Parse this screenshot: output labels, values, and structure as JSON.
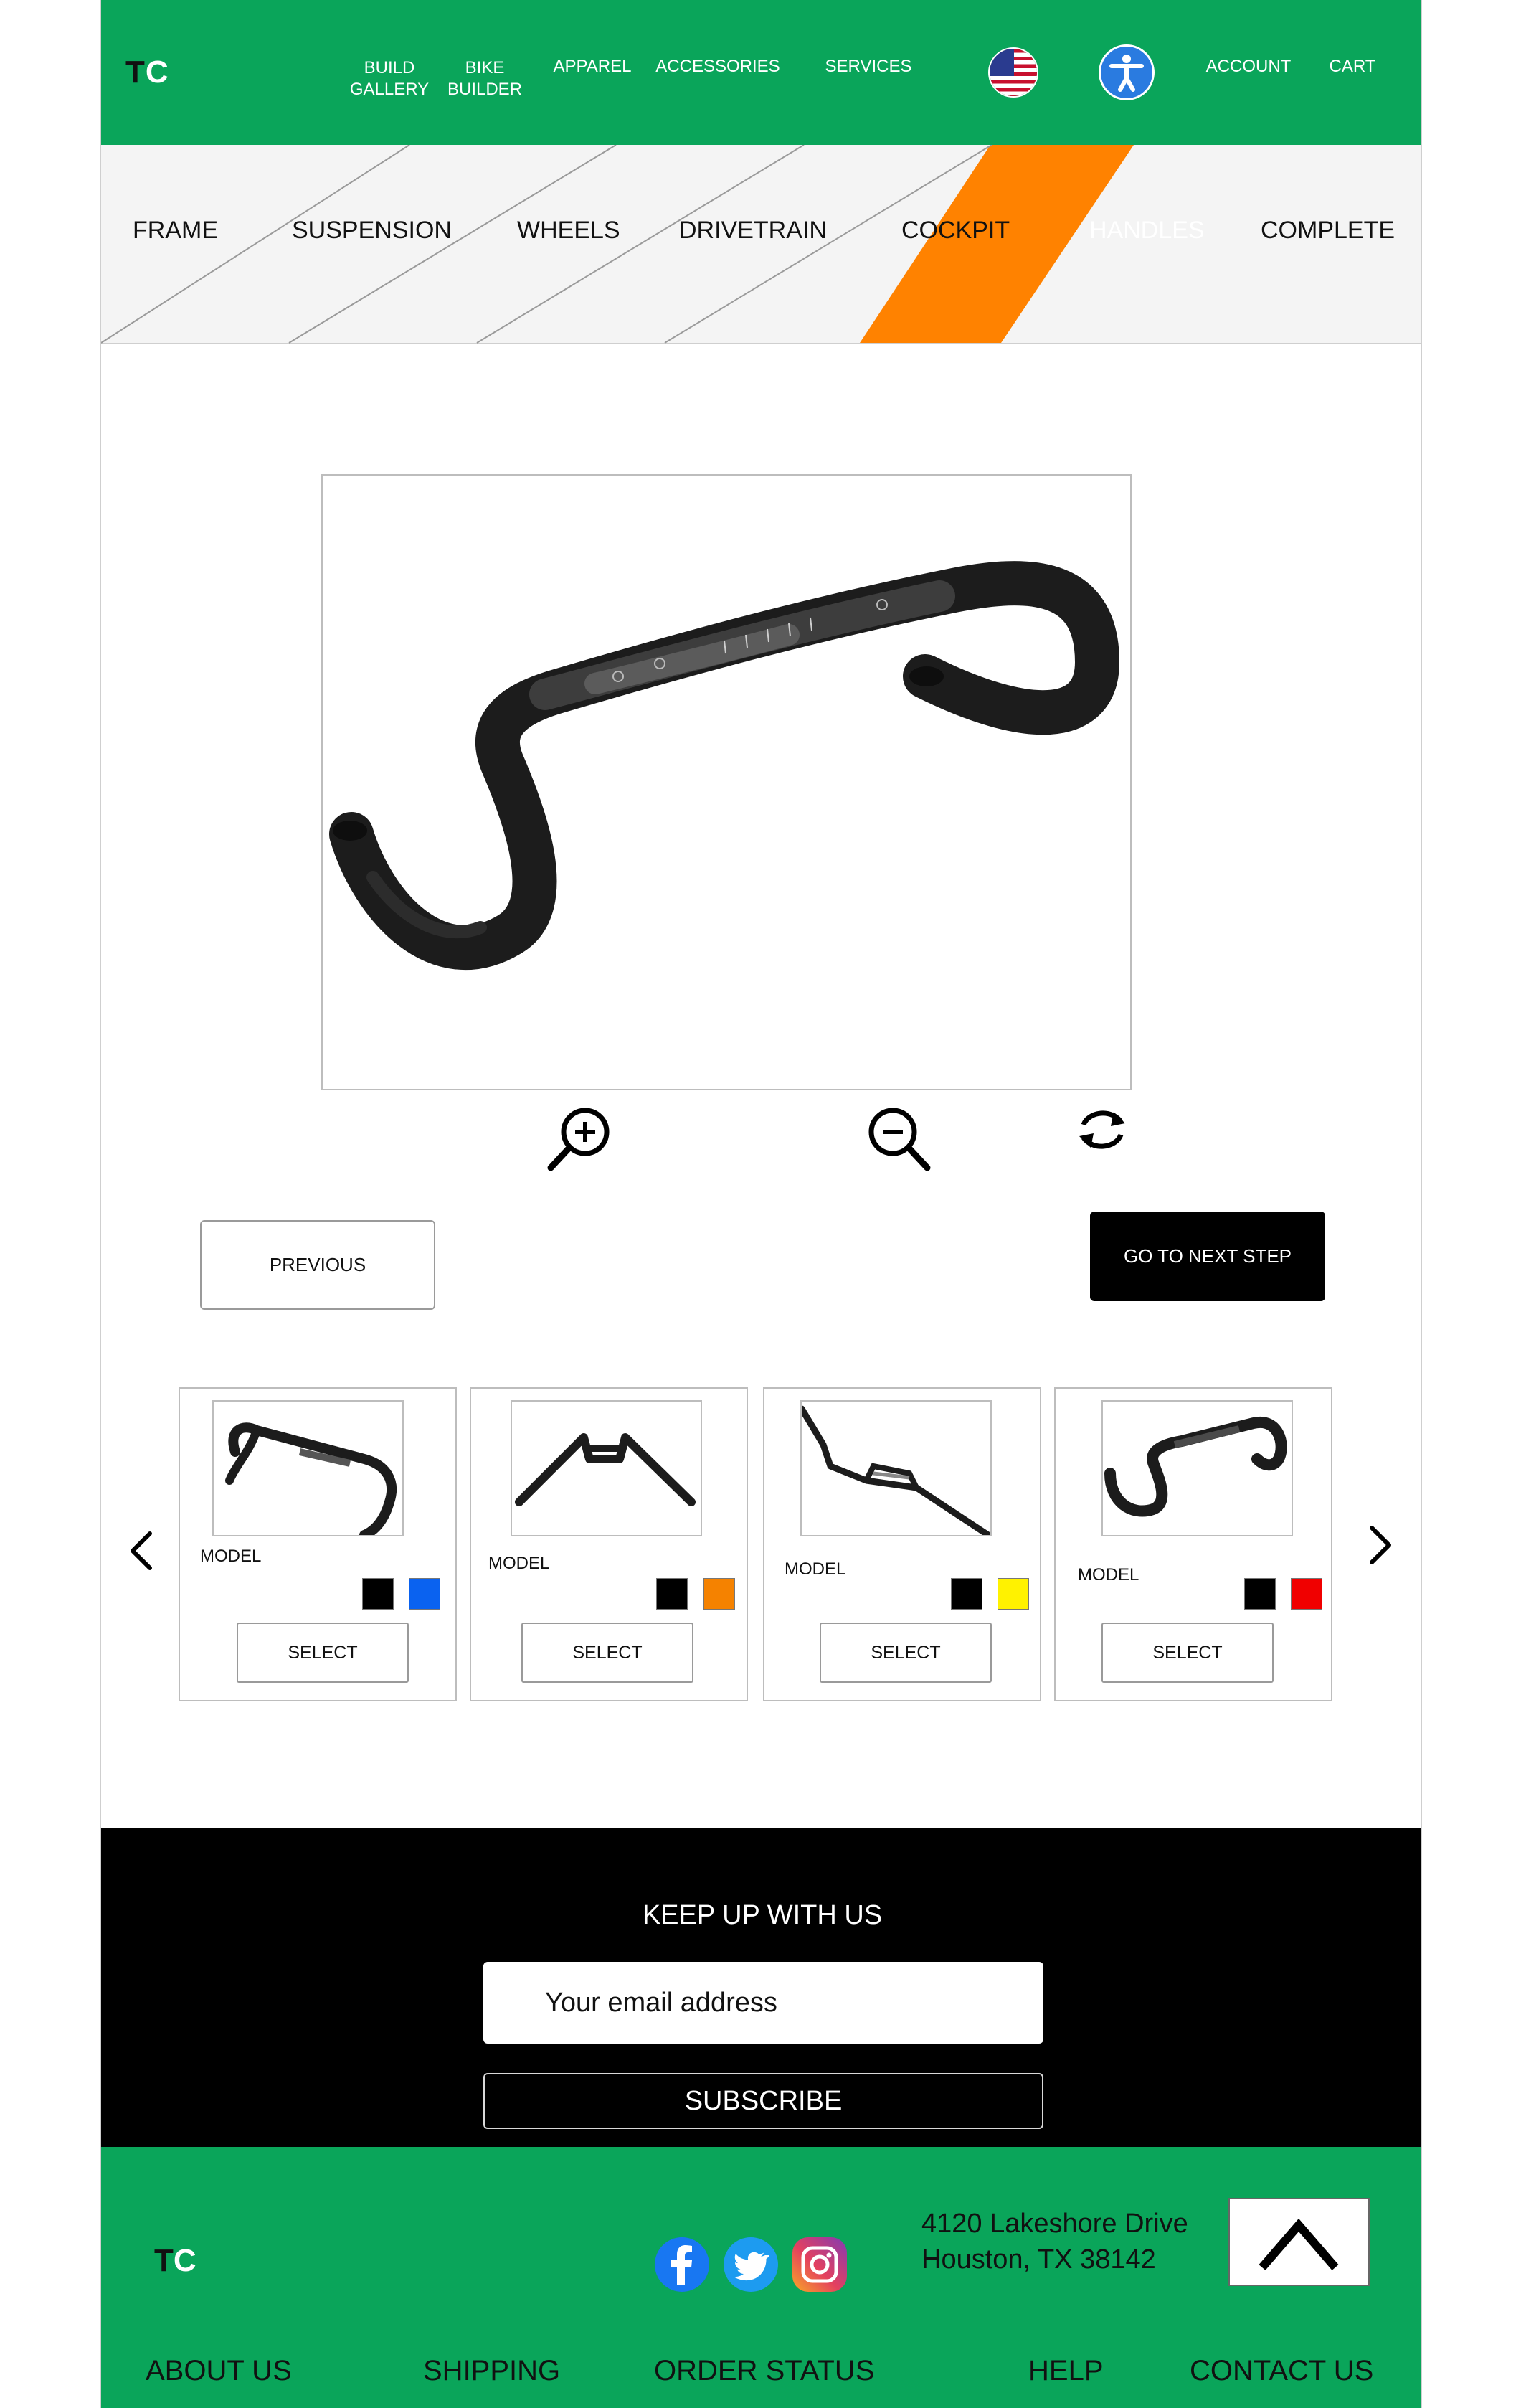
{
  "header": {
    "logo": {
      "t": "T",
      "c": "C"
    },
    "nav": [
      {
        "id": "build-gallery",
        "line1": "BUILD",
        "line2": "GALLERY"
      },
      {
        "id": "bike-builder",
        "line1": "BIKE",
        "line2": "BUILDER"
      },
      {
        "id": "apparel",
        "line1": "APPAREL",
        "line2": ""
      },
      {
        "id": "accessories",
        "line1": "ACCESSORIES",
        "line2": ""
      },
      {
        "id": "services",
        "line1": "SERVICES",
        "line2": ""
      },
      {
        "id": "account",
        "line1": "ACCOUNT",
        "line2": ""
      },
      {
        "id": "cart",
        "line1": "CART",
        "line2": ""
      }
    ],
    "flag_icon": "us-flag-icon",
    "accessibility_icon": "accessibility-icon"
  },
  "steps": {
    "items": [
      "FRAME",
      "SUSPENSION",
      "WHEELS",
      "DRIVETRAIN",
      "COCKPIT",
      "HANDLES",
      "COMPLETE"
    ],
    "active": "HANDLES",
    "active_color": "#ff8200"
  },
  "viewer": {
    "tools": [
      "zoom-in-icon",
      "zoom-out-icon",
      "rotate-icon"
    ]
  },
  "actions": {
    "previous": "PREVIOUS",
    "next": "GO TO NEXT STEP"
  },
  "products": [
    {
      "model": "MODEL",
      "swatches": [
        "#000000",
        "#0a62f0"
      ],
      "select": "SELECT"
    },
    {
      "model": "MODEL",
      "swatches": [
        "#000000",
        "#f58200"
      ],
      "select": "SELECT"
    },
    {
      "model": "MODEL",
      "swatches": [
        "#000000",
        "#fff200"
      ],
      "select": "SELECT"
    },
    {
      "model": "MODEL",
      "swatches": [
        "#000000",
        "#f00000"
      ],
      "select": "SELECT"
    }
  ],
  "newsletter": {
    "title": "KEEP UP WITH US",
    "placeholder": "Your email address",
    "button": "SUBSCRIBE"
  },
  "footer": {
    "logo": {
      "t": "T",
      "c": "C"
    },
    "address_line1": "4120 Lakeshore Drive",
    "address_line2": "Houston, TX 38142",
    "social": [
      "facebook-icon",
      "twitter-icon",
      "instagram-icon"
    ],
    "links": [
      "ABOUT US",
      "SHIPPING",
      "ORDER STATUS",
      "HELP",
      "CONTACT US"
    ]
  },
  "colors": {
    "brand_green": "#0aa55a",
    "accent_orange": "#ff8200"
  }
}
